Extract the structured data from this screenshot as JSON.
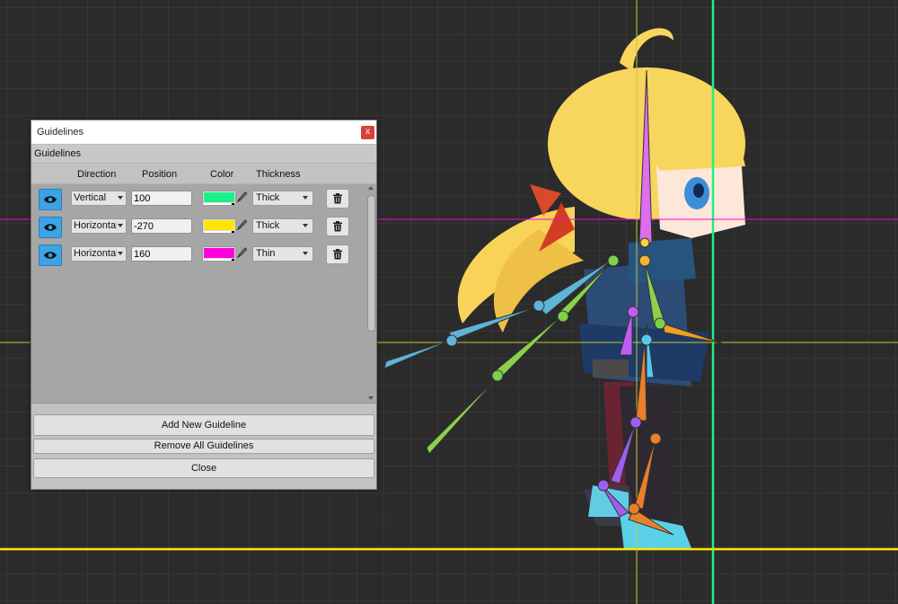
{
  "dialog": {
    "title": "Guidelines",
    "close_label": "x",
    "section_label": "Guidelines",
    "columns": [
      "Direction",
      "Position",
      "Color",
      "Thickness"
    ],
    "rows": [
      {
        "direction": "Vertical",
        "position": "100",
        "color": "#1df088",
        "thickness": "Thick"
      },
      {
        "direction": "Horizontal",
        "position": "-270",
        "color": "#ffe600",
        "thickness": "Thick"
      },
      {
        "direction": "Horizontal",
        "position": "160",
        "color": "#ff00e0",
        "thickness": "Thin"
      }
    ],
    "buttons": {
      "add": "Add New Guideline",
      "remove_all": "Remove All Guidelines",
      "close": "Close"
    }
  },
  "colors": {
    "canvas_bg": "#2b2b2b",
    "grid": "#3f3f3f",
    "accent_eye": "#3ba3e6",
    "close_button": "#d8413a",
    "guide_vertical_green": "#1df088",
    "guide_yellow": "#ffe600",
    "guide_magenta": "#ff00e0"
  }
}
